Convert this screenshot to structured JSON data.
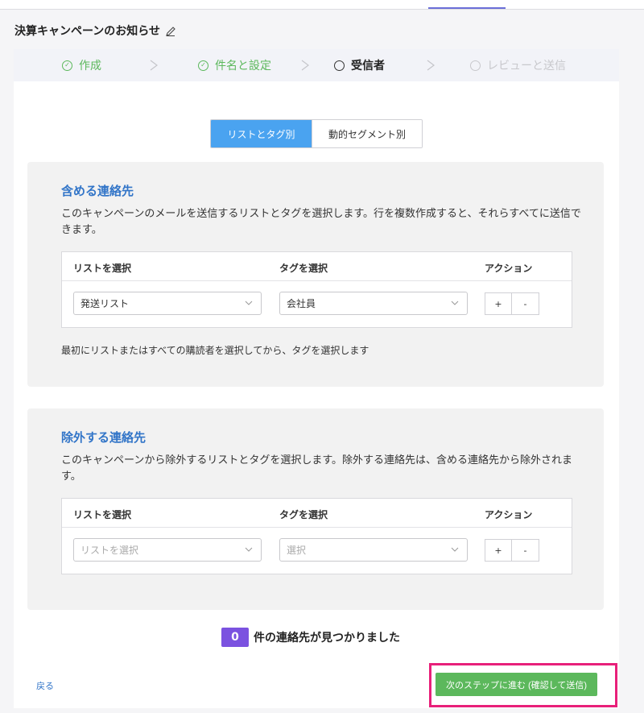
{
  "page": {
    "title": "決算キャンペーンのお知らせ"
  },
  "stepper": {
    "steps": [
      {
        "label": "作成",
        "state": "done"
      },
      {
        "label": "件名と設定",
        "state": "done"
      },
      {
        "label": "受信者",
        "state": "active"
      },
      {
        "label": "レビューと送信",
        "state": "todo"
      }
    ]
  },
  "segment": {
    "options": [
      "リストとタグ別",
      "動的セグメント別"
    ],
    "selected": "リストとタグ別"
  },
  "include": {
    "title": "含める連絡先",
    "description": "このキャンペーンのメールを送信するリストとタグを選択します。行を複数作成すると、それらすべてに送信できます。",
    "columns": [
      "リストを選択",
      "タグを選択",
      "アクション"
    ],
    "row": {
      "list_value": "発送リスト",
      "tag_value": "会社員"
    },
    "add_label": "+",
    "remove_label": "-",
    "hint": "最初にリストまたはすべての購読者を選択してから、タグを選択します"
  },
  "exclude": {
    "title": "除外する連絡先",
    "description": "このキャンペーンから除外するリストとタグを選択します。除外する連絡先は、含める連絡先から除外されます。",
    "columns": [
      "リストを選択",
      "タグを選択",
      "アクション"
    ],
    "row": {
      "list_placeholder": "リストを選択",
      "tag_placeholder": "選択"
    },
    "add_label": "+",
    "remove_label": "-"
  },
  "summary": {
    "count": "0",
    "label": "件の連絡先が見つかりました"
  },
  "footer": {
    "back_label": "戻る",
    "next_label": "次のステップに進む (確認して送信)"
  },
  "colors": {
    "accent_blue": "#4aa3f0",
    "title_blue": "#3275c8",
    "done_green": "#5cb85c",
    "count_purple": "#7b52e0",
    "highlight_pink": "#e8207a"
  }
}
